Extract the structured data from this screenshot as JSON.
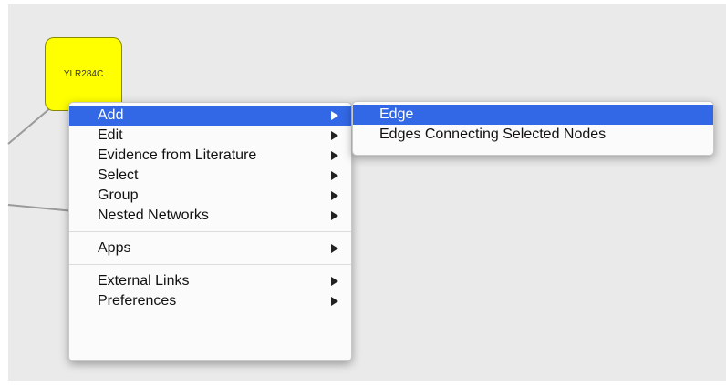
{
  "network": {
    "node_label": "YLR284C",
    "node_color": "#ffff00",
    "background_color": "#eaeaea"
  },
  "context_menu": {
    "groups": [
      [
        {
          "label": "Add",
          "has_submenu": true,
          "highlighted": true
        },
        {
          "label": "Edit",
          "has_submenu": true
        },
        {
          "label": "Evidence from Literature",
          "has_submenu": true
        },
        {
          "label": "Select",
          "has_submenu": true
        },
        {
          "label": "Group",
          "has_submenu": true
        },
        {
          "label": "Nested Networks",
          "has_submenu": true
        }
      ],
      [
        {
          "label": "Apps",
          "has_submenu": true
        }
      ],
      [
        {
          "label": "External Links",
          "has_submenu": true
        },
        {
          "label": "Preferences",
          "has_submenu": true
        }
      ]
    ],
    "highlight_color": "#3268e6"
  },
  "add_submenu": {
    "items": [
      {
        "label": "Edge",
        "highlighted": true
      },
      {
        "label": "Edges Connecting Selected Nodes",
        "highlighted": false
      }
    ]
  }
}
